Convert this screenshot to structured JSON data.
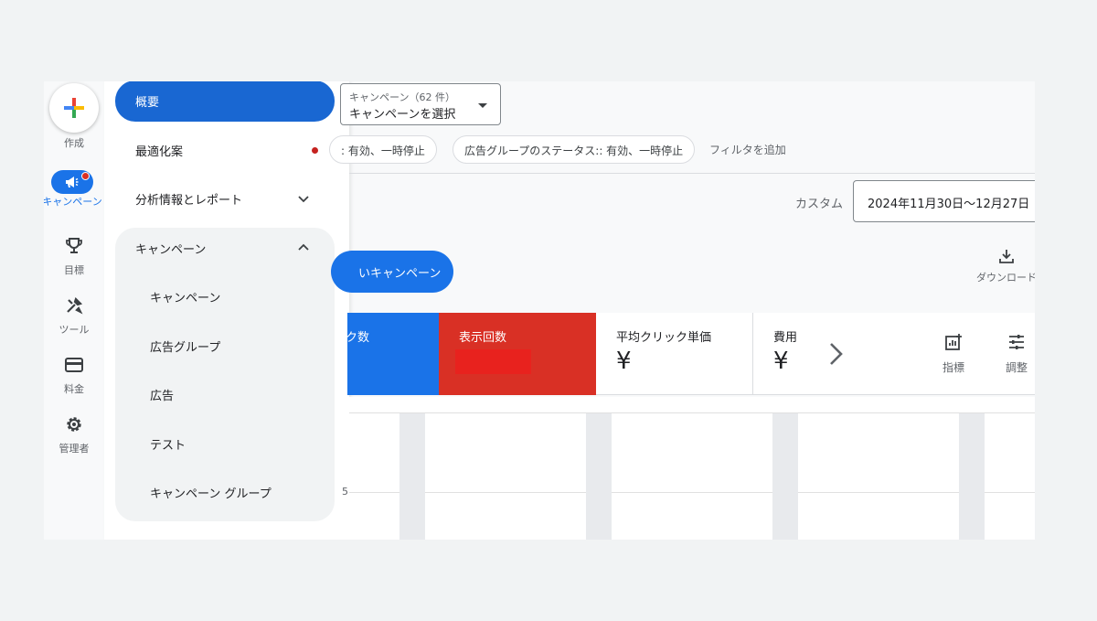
{
  "rail": {
    "create_label": "作成",
    "campaigns_label": "キャンペーン",
    "goals_label": "目標",
    "tools_label": "ツール",
    "billing_label": "料金",
    "admin_label": "管理者"
  },
  "nav": {
    "overview": "概要",
    "recommendations": "最適化案",
    "insights": "分析情報とレポート",
    "campaigns_group": "キャンペーン",
    "sub_items": [
      "キャンペーン",
      "広告グループ",
      "広告",
      "テスト",
      "キャンペーン グループ"
    ]
  },
  "header": {
    "campaign_select_small": "キャンペーン（62 件）",
    "campaign_select_value": "キャンペーンを選択",
    "chip1": ": 有効、一時停止",
    "chip2": "広告グループのステータス:: 有効、一時停止",
    "add_filter": "フィルタを追加",
    "custom_label": "カスタム",
    "date_range": "2024年11月30日〜12月27日",
    "new_campaign": "いキャンペーン",
    "download": "ダウンロード"
  },
  "metrics": {
    "clicks_title": "ク数",
    "impressions_title": "表示回数",
    "avg_cpc_title": "平均クリック単価",
    "avg_cpc_value": "¥",
    "cost_title": "費用",
    "cost_value": "¥"
  },
  "tools": {
    "metrics": "指標",
    "adjust": "調整",
    "download": "ダウ"
  },
  "chart": {
    "tick": "5"
  },
  "colors": {
    "primary": "#1a73e8",
    "active_nav": "#1967d2",
    "impressions": "#d93025"
  }
}
